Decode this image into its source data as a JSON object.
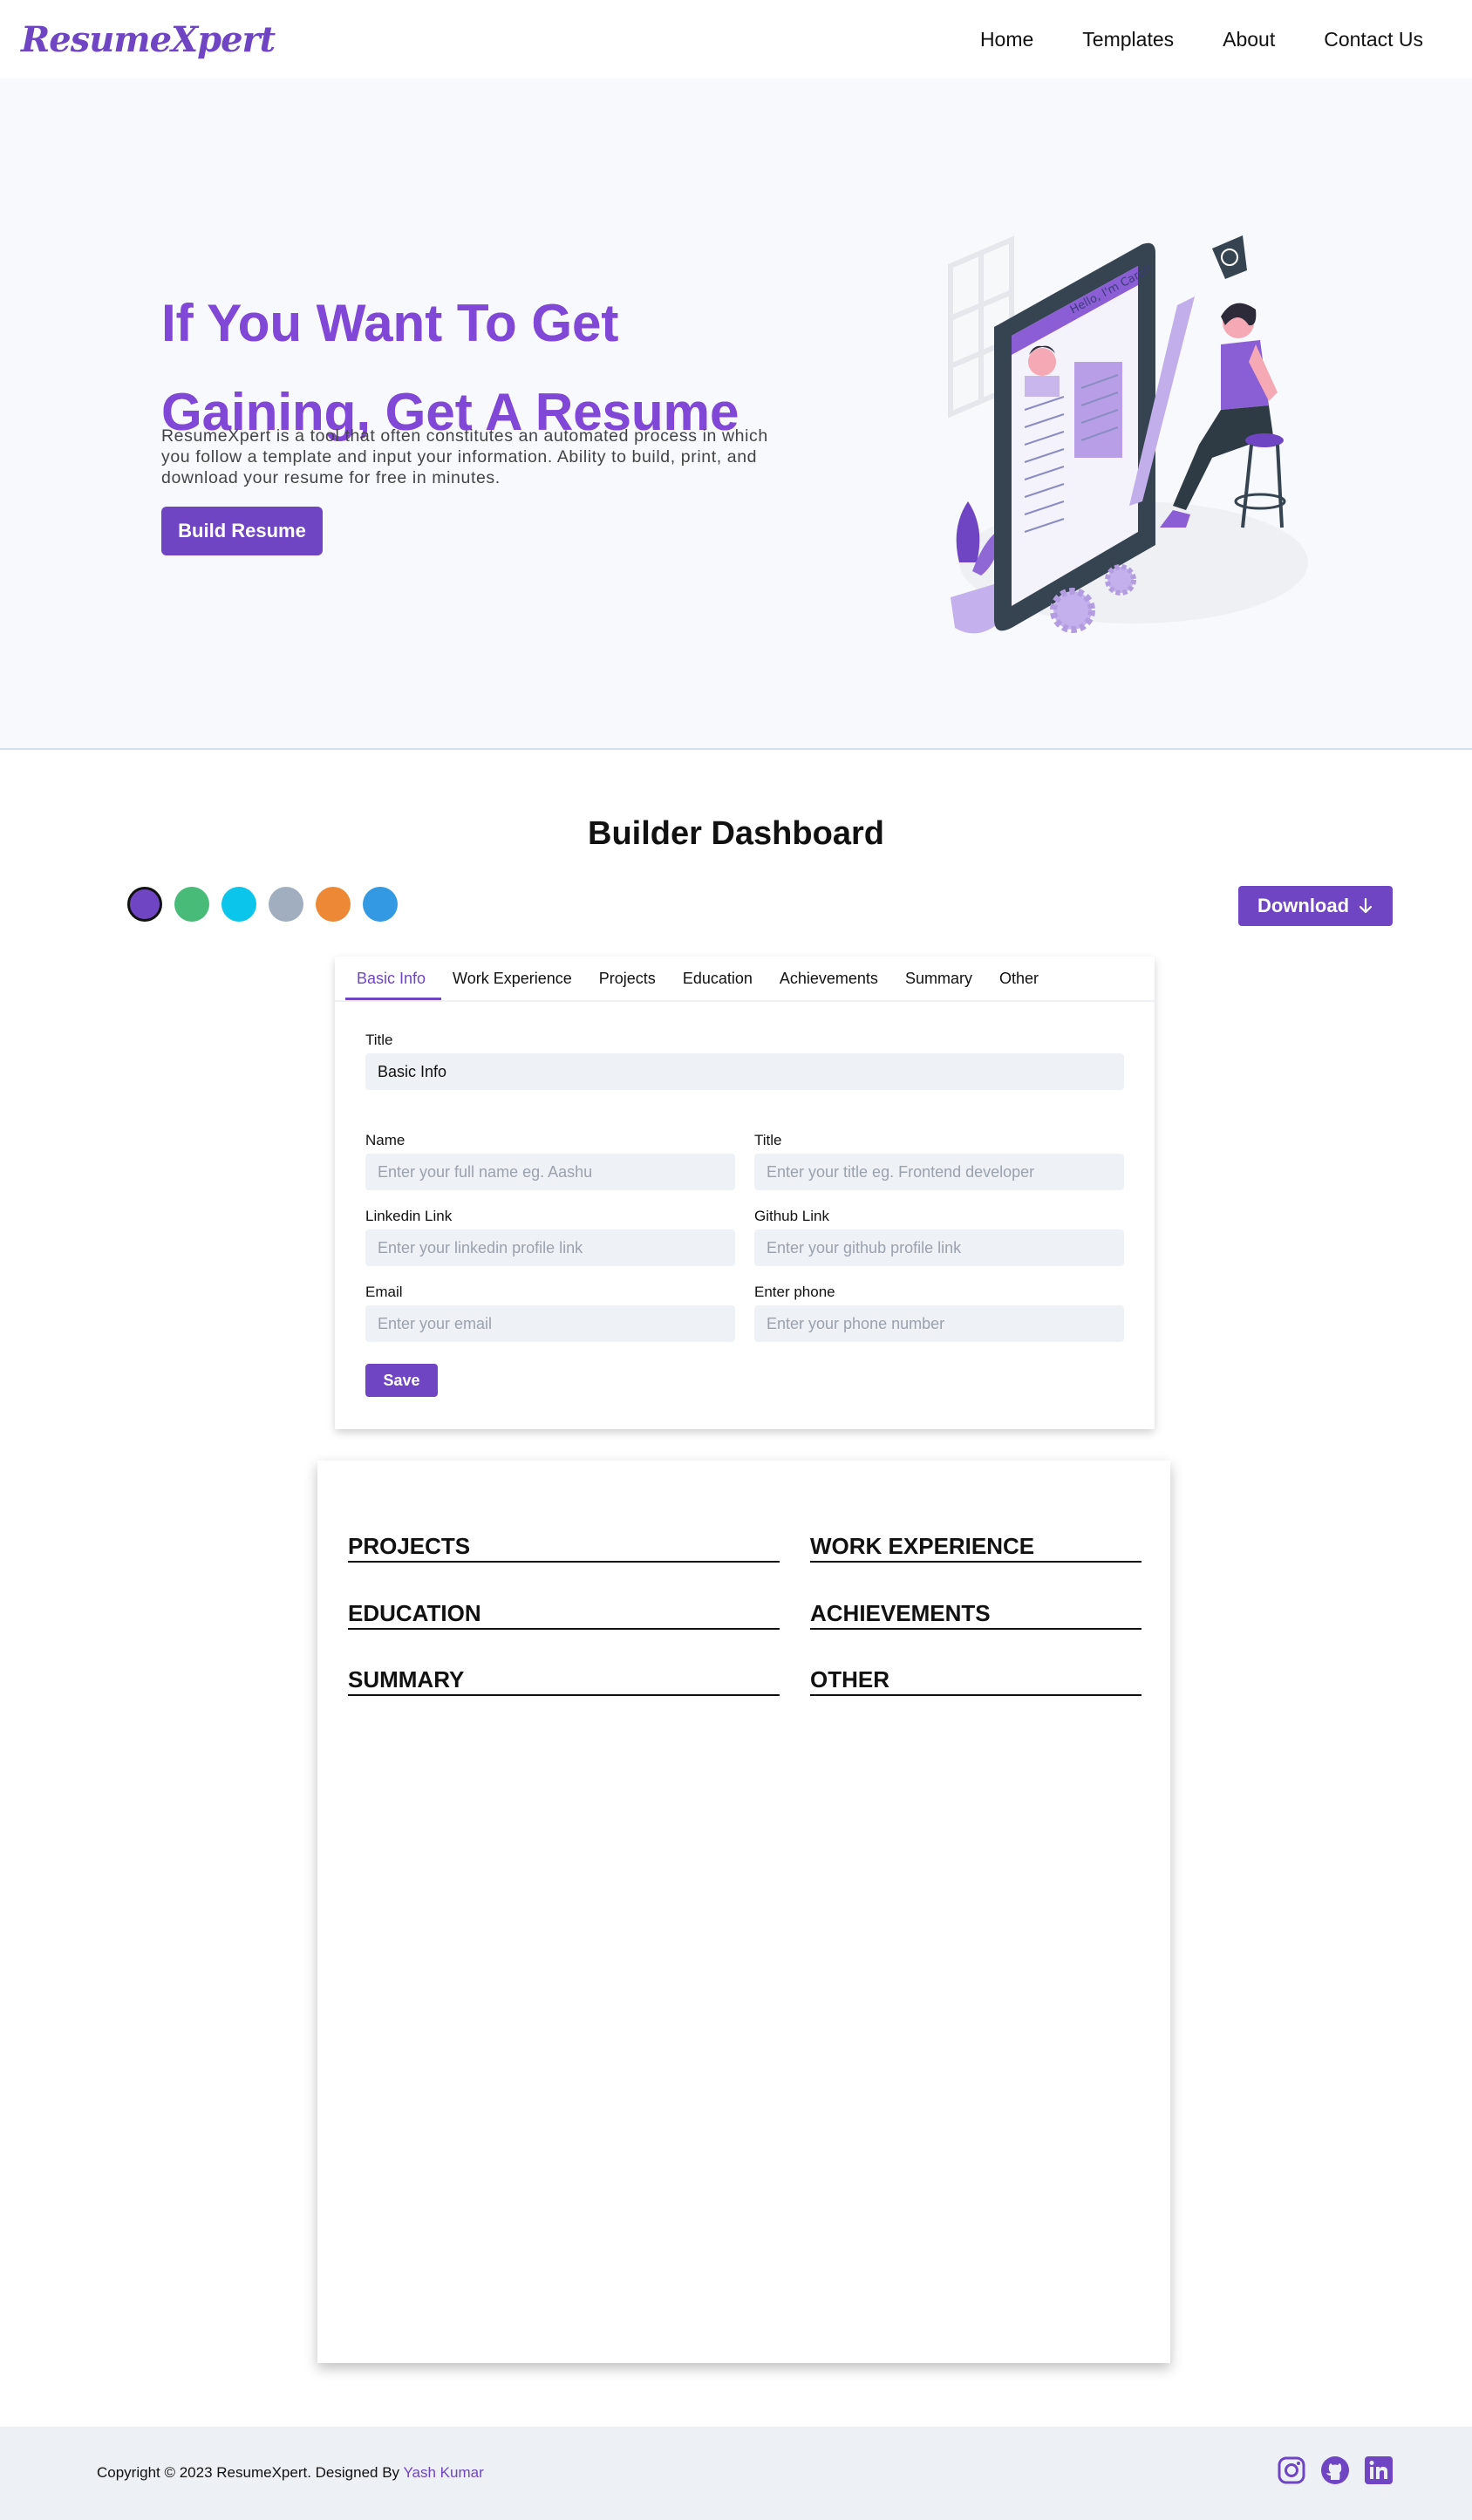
{
  "brand": {
    "logo": "ResumeXpert"
  },
  "nav": {
    "items": [
      "Home",
      "Templates",
      "About",
      "Contact Us"
    ]
  },
  "hero": {
    "title_line1": "If You Want To Get",
    "title_line2": "Gaining, Get A Resume",
    "description": "ResumeXpert is a tool that often constitutes an automated process in which you follow a template and input your information. Ability to build, print, and download your resume for free in minutes.",
    "cta": "Build Resume",
    "illustration_text": "Hello, I'm Carol!"
  },
  "dashboard": {
    "title": "Builder Dashboard",
    "download_label": "Download",
    "colors": [
      "#6f45c4",
      "#48bb78",
      "#0bc5ea",
      "#a0aec0",
      "#ed8936",
      "#3399e2"
    ],
    "tabs": [
      "Basic Info",
      "Work Experience",
      "Projects",
      "Education",
      "Achievements",
      "Summary",
      "Other"
    ],
    "active_tab": "Basic Info",
    "form": {
      "section_title_label": "Title",
      "section_title_value": "Basic Info",
      "name_label": "Name",
      "name_placeholder": "Enter your full name eg. Aashu",
      "title_label": "Title",
      "title_placeholder": "Enter your title eg. Frontend developer",
      "linkedin_label": "Linkedin Link",
      "linkedin_placeholder": "Enter your linkedin profile link",
      "github_label": "Github Link",
      "github_placeholder": "Enter your github profile link",
      "email_label": "Email",
      "email_placeholder": "Enter your email",
      "phone_label": "Enter phone",
      "phone_placeholder": "Enter your phone number",
      "save_label": "Save"
    }
  },
  "preview": {
    "sections": {
      "projects": "PROJECTS",
      "work": "WORK EXPERIENCE",
      "education": "EDUCATION",
      "achievements": "ACHIEVEMENTS",
      "summary": "SUMMARY",
      "other": "OTHER"
    }
  },
  "footer": {
    "copyright": "Copyright © 2023 ResumeXpert. Designed By ",
    "author": "Yash Kumar",
    "socials": [
      "instagram-icon",
      "github-icon",
      "linkedin-icon"
    ]
  }
}
